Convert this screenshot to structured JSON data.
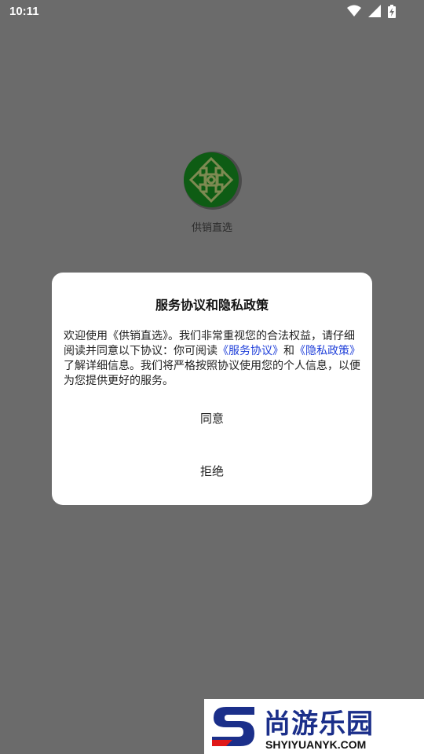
{
  "status_bar": {
    "time": "10:11",
    "icons": [
      "wifi-icon",
      "signal-icon",
      "battery-charging-icon"
    ]
  },
  "app": {
    "name": "供销直选",
    "logo_icon": "app-logo-icon",
    "logo_colors": {
      "outer": "#1a7d1a",
      "inner": "#8a9a5b"
    }
  },
  "dialog": {
    "title": "服务协议和隐私政策",
    "body_part1": "欢迎使用《供销直选》。我们非常重视您的合法权益，请仔细阅读并同意以下协议：你可阅读",
    "link_service": "《服务协议》",
    "body_and": "和",
    "link_privacy": "《隐私政策》",
    "body_part2": "了解详细信息。我们将严格按照协议使用您的个人信息，以便为您提供更好的服务。",
    "agree_label": "同意",
    "refuse_label": "拒绝",
    "link_color": "#1f3fd9"
  },
  "watermark": {
    "name": "尚游乐园",
    "domain": "SHYIYUANYK.COM",
    "logo_icon": "s-logo-icon"
  }
}
